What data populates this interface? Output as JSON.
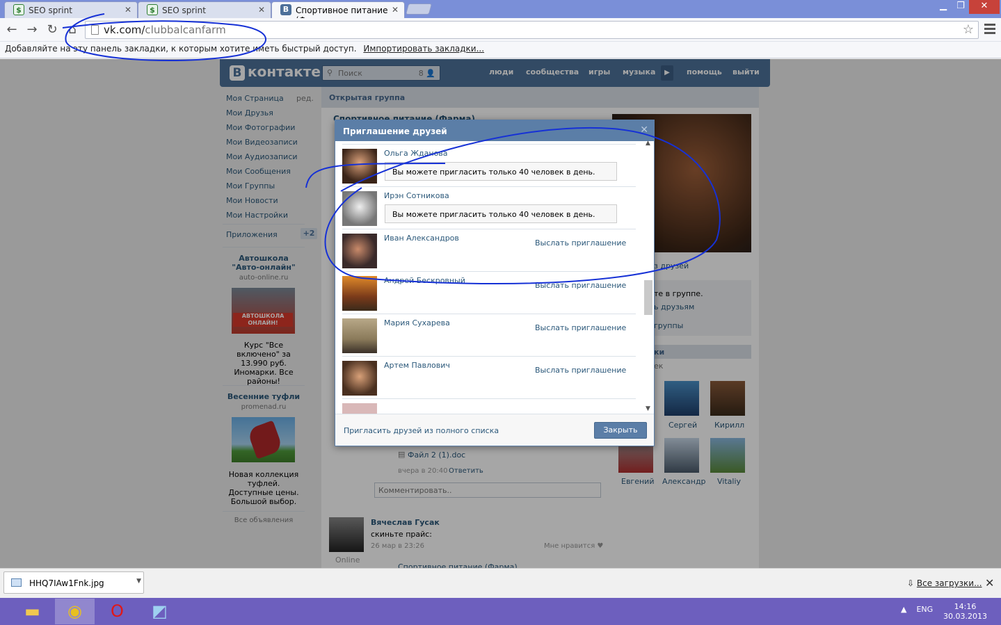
{
  "browser": {
    "tabs": [
      {
        "title": "SEO sprint",
        "favicon": "seosprint-icon"
      },
      {
        "title": "SEO sprint",
        "favicon": "seosprint-icon"
      },
      {
        "title": "Спортивное питание (Фа",
        "favicon": "vk-icon"
      }
    ],
    "url_host": "vk.com/",
    "url_path": "clubbalcanfarm",
    "bookmarks_hint": "Добавляйте на эту панель закладки, к которым хотите иметь быстрый доступ.",
    "import_link": "Импортировать закладки..."
  },
  "vk": {
    "logo": "контакте",
    "logo_letter": "В",
    "search_placeholder": "Поиск",
    "search_count": "8",
    "nav": [
      "люди",
      "сообщества",
      "игры",
      "музыка",
      "помощь",
      "выйти"
    ],
    "menu": [
      "Моя Страница",
      "Мои Друзья",
      "Мои Фотографии",
      "Мои Видеозаписи",
      "Мои Аудиозаписи",
      "Мои Сообщения",
      "Мои Группы",
      "Мои Новости",
      "Мои Настройки"
    ],
    "menu_edit": "ред.",
    "apps_label": "Приложения",
    "apps_badge": "+2",
    "ads": [
      {
        "title": "Автошкола \"Авто-онлайн\"",
        "site": "auto-online.ru",
        "text": "Курс \"Все включено\" за 13.990 руб. Иномарки. Все районы!",
        "banner": "АВТОШКОЛА ОНЛАЙН!"
      },
      {
        "title": "Весенние туфли",
        "site": "promenad.ru",
        "text": "Новая коллекция туфлей. Доступные цены. Большой выбор."
      }
    ],
    "all_ads": "Все объявления",
    "group_header": "Открытая группа",
    "group_name": "Спортивное питание (Фарма)",
    "side_friends_label": "з друзей",
    "side_info": [
      "те в группе.",
      "ь друзьям",
      "группы"
    ],
    "side_section": "ки",
    "side_section2": "ек",
    "friends_grid": [
      {
        "name": "Сергей"
      },
      {
        "name": "Кирилл"
      },
      {
        "name": "Евгений"
      },
      {
        "name": "Александр"
      },
      {
        "name": "Vitaliy"
      }
    ],
    "post_file": "Файл 2 (1).doc",
    "post_time": "вчера в 20:40",
    "post_reply": "Ответить",
    "comment_placeholder": "Комментировать..",
    "post2_author": "Вячеслав Гусак",
    "post2_text": "скиньте прайс:",
    "post2_time": "26 мар в 23:26",
    "post2_like": "Мне нравится",
    "post2_status": "Online",
    "post3_title": "Спортивное питание (Фарма)"
  },
  "dialog": {
    "title": "Приглашение друзей",
    "rows": [
      {
        "name": "Ольга Жданова",
        "status": "Вы можете пригласить только 40 человек в день.",
        "action": ""
      },
      {
        "name": "Ирэн Сотникова",
        "status": "Вы можете пригласить только 40 человек в день.",
        "action": ""
      },
      {
        "name": "Иван Александров",
        "status": "",
        "action": "Выслать приглашение"
      },
      {
        "name": "Андрей Бескровный",
        "status": "",
        "action": "Выслать приглашение"
      },
      {
        "name": "Мария Сухарева",
        "status": "",
        "action": "Выслать приглашение"
      },
      {
        "name": "Артем Павлович",
        "status": "",
        "action": "Выслать приглашение"
      }
    ],
    "full_list_link": "Пригласить друзей из полного списка",
    "close_button": "Закрыть"
  },
  "downloads": {
    "file": "HHQ7IAw1Fnk.jpg",
    "all": "Все загрузки..."
  },
  "taskbar": {
    "lang": "ENG",
    "time": "14:16",
    "date": "30.03.2013"
  }
}
